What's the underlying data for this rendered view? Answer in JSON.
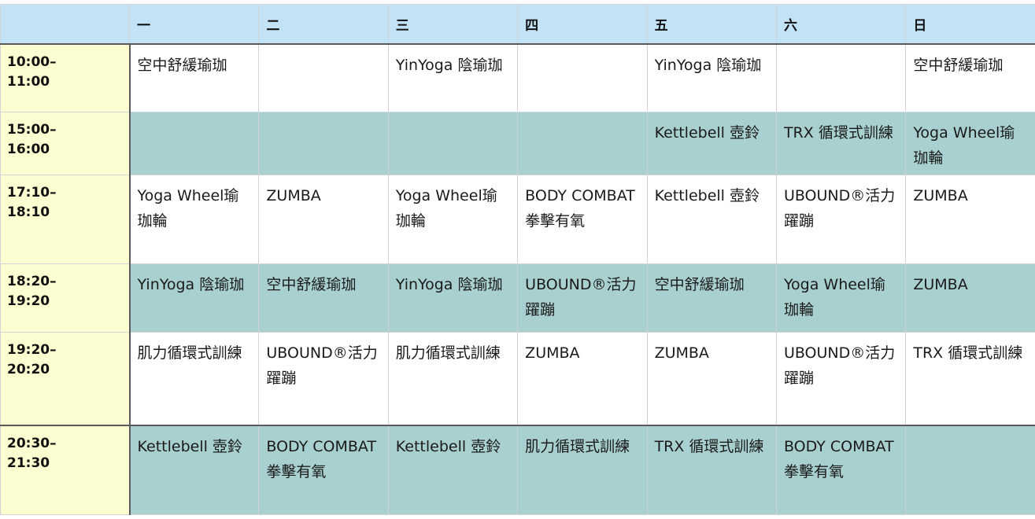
{
  "schedule": {
    "days": [
      "一",
      "二",
      "三",
      "四",
      "五",
      "六",
      "日"
    ],
    "rows": [
      {
        "time": "10:00–\n11:00",
        "cells": [
          "空中舒緩瑜珈",
          "",
          "YinYoga 陰瑜珈",
          "",
          "YinYoga 陰瑜珈",
          "",
          "空中舒緩瑜珈"
        ]
      },
      {
        "time": "15:00–\n16:00",
        "cells": [
          "",
          "",
          "",
          "",
          "Kettlebell 壺鈴",
          "TRX 循環式訓練",
          "Yoga Wheel瑜珈輪"
        ]
      },
      {
        "time": "17:10–\n18:10",
        "cells": [
          "Yoga Wheel瑜珈輪",
          "ZUMBA",
          "Yoga Wheel瑜珈輪",
          "BODY COMBAT拳擊有氧",
          "Kettlebell 壺鈴",
          "UBOUND®活力躍蹦",
          "ZUMBA"
        ]
      },
      {
        "time": "18:20–\n19:20",
        "cells": [
          "YinYoga 陰瑜珈",
          "空中舒緩瑜珈",
          "YinYoga 陰瑜珈",
          "UBOUND®活力躍蹦",
          "空中舒緩瑜珈",
          "Yoga Wheel瑜珈輪",
          "ZUMBA"
        ]
      },
      {
        "time": "19:20–\n20:20",
        "cells": [
          "肌力循環式訓練",
          "UBOUND®活力躍蹦",
          "肌力循環式訓練",
          "ZUMBA",
          "ZUMBA",
          "UBOUND®活力躍蹦",
          "TRX 循環式訓練"
        ]
      },
      {
        "time": "20:30–\n21:30",
        "cells": [
          "Kettlebell 壺鈴",
          "BODY COMBAT拳擊有氧",
          "Kettlebell 壺鈴",
          "肌力循環式訓練",
          "TRX 循環式訓練",
          "BODY COMBAT拳擊有氧",
          ""
        ]
      }
    ]
  }
}
